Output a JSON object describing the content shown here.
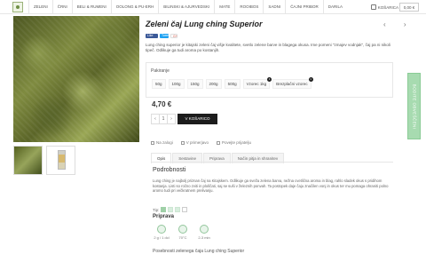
{
  "nav": {
    "items": [
      "ZELENI",
      "ČRNI",
      "BELI & RUMENI",
      "OOLONG & PU-ERH",
      "BILINSKI & AJURVEDSKI",
      "MATE",
      "ROOIBOS",
      "SADNI",
      "ČAJNI PRIBOR",
      "DARILA"
    ],
    "cart_label": "KOŠARICA",
    "cart_total": "0,00 €"
  },
  "product": {
    "title": "Zeleni čaj Lung ching Superior",
    "nav_arrows": "‹ ›",
    "social": {
      "like": "Like",
      "tweet": "Tweet",
      "gplus": "G+"
    },
    "description": "Lung ching superior je kitajski zeleni čaj višje kvalitete, svetlo zelene barve in blagega okusa. Ime pomeni \"zmajev vodnjak\", čaj pa ni nikoli tipeč. Odlikuje ga tudi aroma po kostanjih.",
    "pack_label": "Pakiranje",
    "pack_options": [
      {
        "label": "50g",
        "badge": ""
      },
      {
        "label": "100g",
        "badge": ""
      },
      {
        "label": "150g",
        "badge": ""
      },
      {
        "label": "200g",
        "badge": ""
      },
      {
        "label": "500g",
        "badge": ""
      },
      {
        "label": "Vzorec 1kg",
        "badge": "1"
      },
      {
        "label": "Brezplačni vzorec",
        "badge": "1"
      }
    ],
    "price": "4,70 €",
    "qty_minus": "‹",
    "qty_value": "1",
    "qty_plus": "›",
    "add_to_cart": "V KOŠARICO"
  },
  "links": {
    "stock": "Na zalogi",
    "compare": "V primerjavo",
    "recommend": "Povejte prijatelju"
  },
  "tabs": [
    "Opis",
    "Sestavine",
    "Priprava",
    "Način pitja in shranitev"
  ],
  "content": {
    "title": "Podrobnosti",
    "body": "Lung ching je najbolj priznan čaj na Kitajskem. Odlikuje ga sveža zelena barva, nežna cvetlična aroma in blag, rahlo sladek okus s pridihom kostanja. Listi so ročno zviti in ploščati, saj se suši v železnih ponvah. Ta postopek daje čaju značilen vonj in okus ter mu pomaga ohraniti polno aromo tudi pri večkratnem prelivanju.",
    "type_label": "Tip:",
    "prep_title": "Priprava",
    "prep": [
      {
        "value": "2 g / 1 dcl"
      },
      {
        "value": "70°C"
      },
      {
        "value": "2-3 min"
      }
    ],
    "footer_title": "Posebnosti zelenega čaja Lung ching Superior"
  },
  "side_button": "BODITE OBVEŠČENI"
}
